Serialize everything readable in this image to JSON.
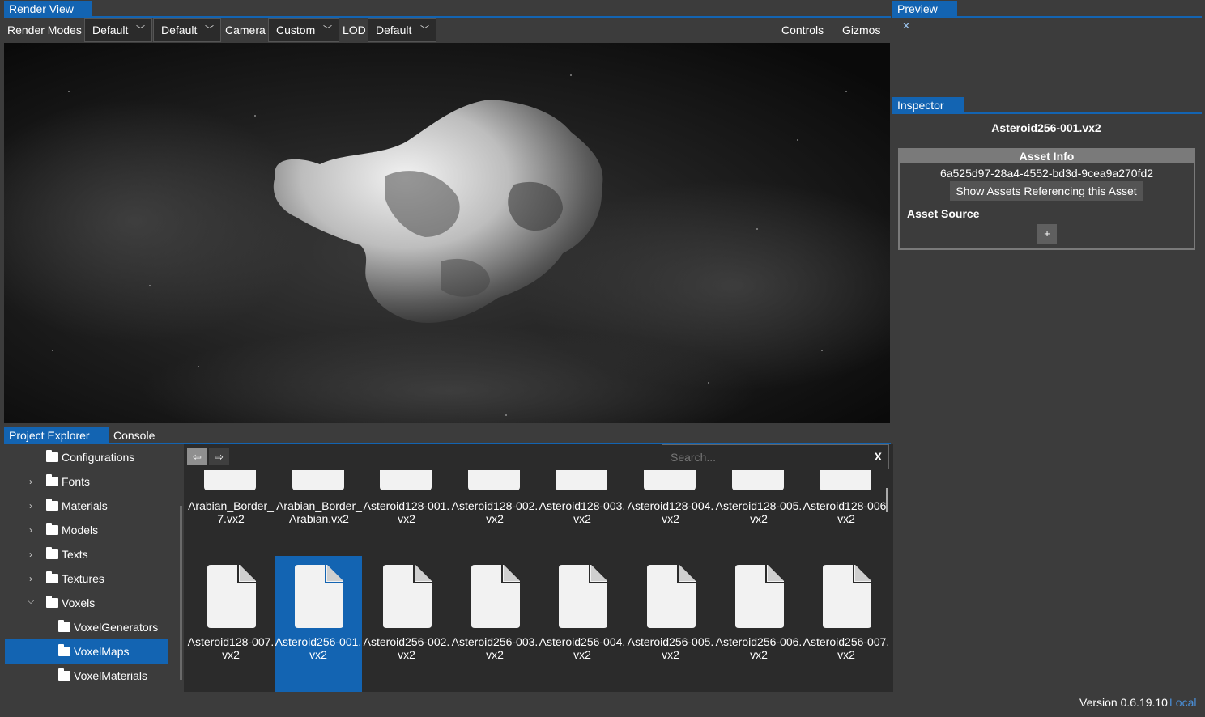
{
  "render_view": {
    "tab_label": "Render View",
    "toolbar": {
      "render_modes_label": "Render Modes",
      "dropdown1_value": "Default",
      "dropdown2_value": "Default",
      "camera_label": "Camera",
      "camera_value": "Custom",
      "lod_label": "LOD",
      "lod_value": "Default",
      "controls_label": "Controls",
      "gizmos_label": "Gizmos"
    }
  },
  "preview": {
    "tab_label": "Preview",
    "close_glyph": "✕"
  },
  "inspector": {
    "tab_label": "Inspector",
    "asset_name": "Asteroid256-001.vx2",
    "asset_info": {
      "header": "Asset Info",
      "guid": "6a525d97-28a4-4552-bd3d-9cea9a270fd2",
      "show_refs_button": "Show Assets Referencing this Asset",
      "asset_source_label": "Asset Source",
      "add_button": "+"
    }
  },
  "bottom_tabs": {
    "project_explorer": "Project Explorer",
    "console": "Console"
  },
  "search": {
    "placeholder": "Search...",
    "clear_label": "X"
  },
  "tree": [
    {
      "label": "Configurations",
      "level": 0,
      "arrow": ""
    },
    {
      "label": "Fonts",
      "level": 0,
      "arrow": "›"
    },
    {
      "label": "Materials",
      "level": 0,
      "arrow": "›"
    },
    {
      "label": "Models",
      "level": 0,
      "arrow": "›"
    },
    {
      "label": "Texts",
      "level": 0,
      "arrow": "›"
    },
    {
      "label": "Textures",
      "level": 0,
      "arrow": "›"
    },
    {
      "label": "Voxels",
      "level": 0,
      "arrow": "⌄"
    },
    {
      "label": "VoxelGenerators",
      "level": 1,
      "arrow": ""
    },
    {
      "label": "VoxelMaps",
      "level": 1,
      "arrow": "",
      "selected": true
    },
    {
      "label": "VoxelMaterials",
      "level": 1,
      "arrow": ""
    }
  ],
  "files_row1": [
    "Arabian_Border_7.vx2",
    "Arabian_Border_Arabian.vx2",
    "Asteroid128-001.vx2",
    "Asteroid128-002.vx2",
    "Asteroid128-003.vx2",
    "Asteroid128-004.vx2",
    "Asteroid128-005.vx2",
    "Asteroid128-006.vx2"
  ],
  "files_row2": [
    "Asteroid128-007.vx2",
    "Asteroid256-001.vx2",
    "Asteroid256-002.vx2",
    "Asteroid256-003.vx2",
    "Asteroid256-004.vx2",
    "Asteroid256-005.vx2",
    "Asteroid256-006.vx2",
    "Asteroid256-007.vx2"
  ],
  "selected_file_index": 1,
  "footer": {
    "version": "Version 0.6.19.10",
    "mode": "Local"
  },
  "colors": {
    "accent": "#1364b2",
    "background": "#3c3c3c",
    "local_link": "#4a8fd8"
  },
  "icons": {
    "back": "⇦",
    "forward": "⇨"
  }
}
